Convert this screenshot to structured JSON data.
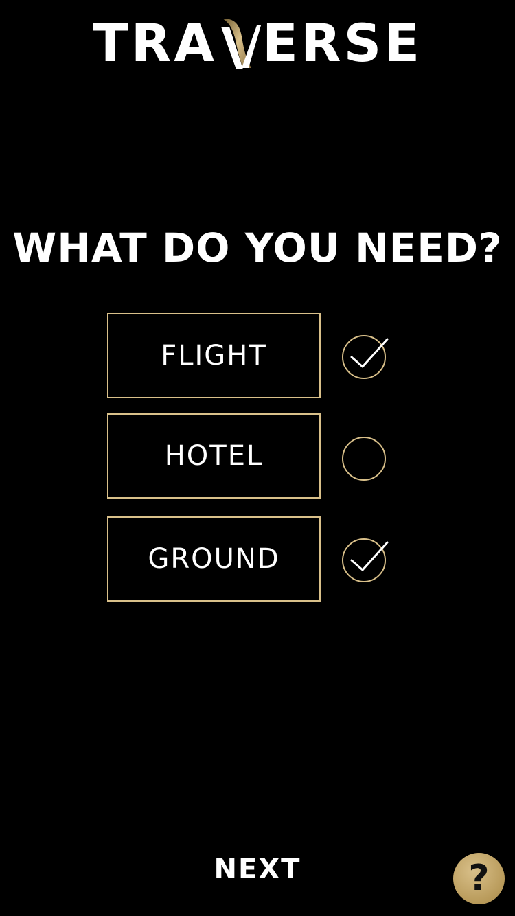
{
  "brand": {
    "logo_left": "TRA",
    "logo_right": "ERSE",
    "accent_color": "#d9c08a"
  },
  "heading": "WHAT DO YOU NEED?",
  "options": [
    {
      "label": "FLIGHT",
      "selected": true
    },
    {
      "label": "HOTEL",
      "selected": false
    },
    {
      "label": "GROUND",
      "selected": true
    }
  ],
  "next_label": "NEXT",
  "help_label": "?",
  "icons": {
    "check": "checkmark-icon",
    "empty": "empty-circle-icon",
    "help": "question-mark-icon"
  }
}
